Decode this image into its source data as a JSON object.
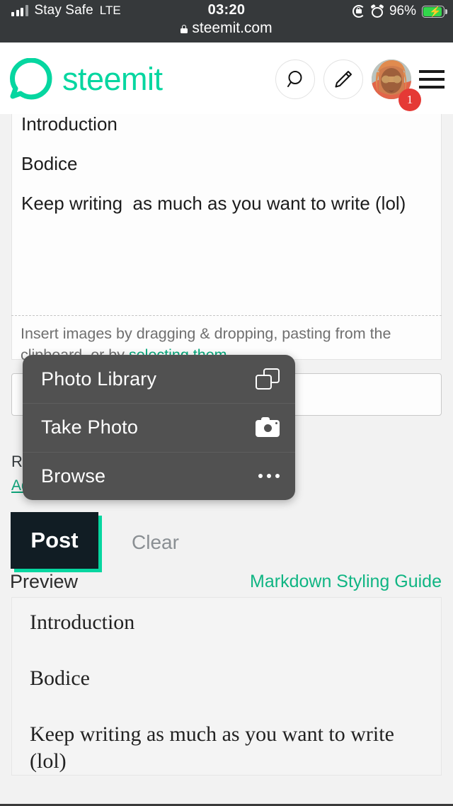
{
  "status_bar": {
    "carrier": "Stay Safe",
    "network": "LTE",
    "time": "03:20",
    "battery_percent": "96%",
    "url": "steemit.com",
    "icons": [
      "signal-icon",
      "rotation-lock-icon",
      "alarm-clock-icon",
      "battery-charging-icon",
      "lock-icon"
    ]
  },
  "header": {
    "brand": "steemit",
    "brand_color": "#06d6a0",
    "search_icon": "search-icon",
    "compose_icon": "pencil-icon",
    "avatar_alt": "user-avatar",
    "notification_count": "1",
    "menu_icon": "hamburger-icon"
  },
  "editor": {
    "lines": [
      "Introduction",
      "",
      "Bodice",
      "",
      "Keep writing  as much as you want to write (lol)"
    ],
    "hint_text": "Insert images by dragging & dropping, pasting from the clipboard, or by ",
    "hint_link": "selecting them",
    "hint_tail": ".",
    "tags_value": "",
    "tags_placeholder": ""
  },
  "options": {
    "rewards_label": "Re",
    "advanced_link": "Ad"
  },
  "action_sheet": {
    "items": [
      {
        "label": "Photo Library",
        "icon": "photo-library-icon"
      },
      {
        "label": "Take Photo",
        "icon": "camera-icon"
      },
      {
        "label": "Browse",
        "icon": "ellipsis-icon"
      }
    ]
  },
  "actions": {
    "post_label": "Post",
    "clear_label": "Clear",
    "post_bg": "#111d24",
    "post_shadow": "#06d6a0"
  },
  "preview": {
    "label": "Preview",
    "markdown_guide": "Markdown Styling Guide",
    "paragraphs": [
      "Introduction",
      "Bodice",
      "Keep writing as much as you want to write (lol)"
    ]
  }
}
